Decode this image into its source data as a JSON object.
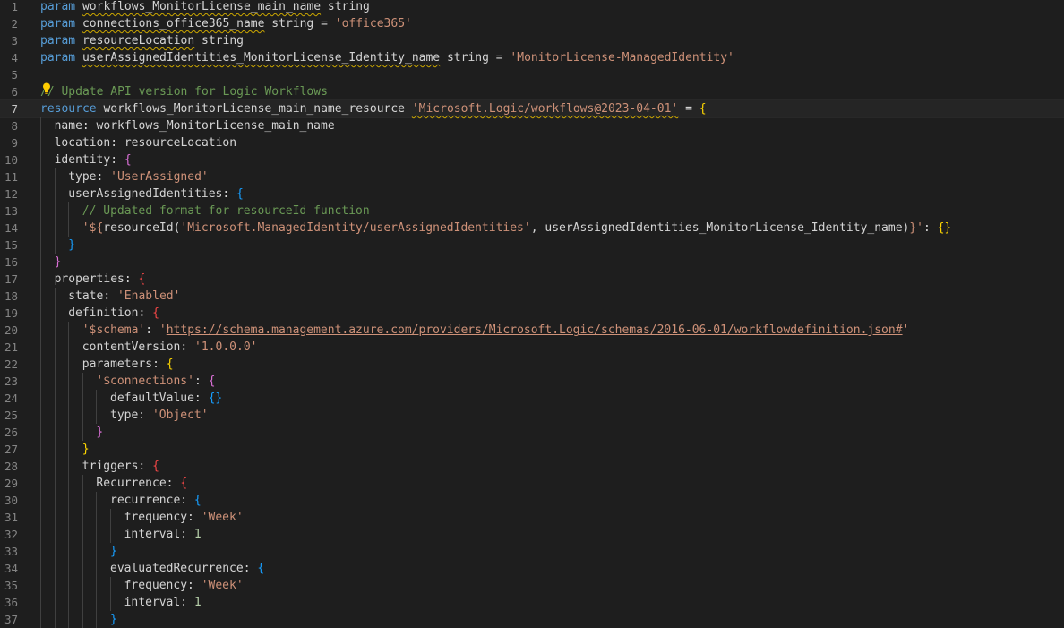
{
  "editor": {
    "lines": [
      {
        "n": "1",
        "indent": 0,
        "tokens": [
          [
            "kw",
            "param"
          ],
          [
            "id",
            " "
          ],
          [
            "id squig",
            "workflows_MonitorLicense_main_name"
          ],
          [
            "id",
            " string"
          ]
        ]
      },
      {
        "n": "2",
        "indent": 0,
        "tokens": [
          [
            "kw",
            "param"
          ],
          [
            "id",
            " "
          ],
          [
            "id squig",
            "connections_office365_name"
          ],
          [
            "id",
            " string = "
          ],
          [
            "str",
            "'office365'"
          ]
        ]
      },
      {
        "n": "3",
        "indent": 0,
        "tokens": [
          [
            "kw",
            "param"
          ],
          [
            "id",
            " "
          ],
          [
            "id squig",
            "resourceLocation"
          ],
          [
            "id",
            " string"
          ]
        ]
      },
      {
        "n": "4",
        "indent": 0,
        "tokens": [
          [
            "kw",
            "param"
          ],
          [
            "id",
            " "
          ],
          [
            "id squig",
            "userAssignedIdentities_MonitorLicense_Identity_name"
          ],
          [
            "id",
            " string = "
          ],
          [
            "str",
            "'MonitorLicense-ManagedIdentity'"
          ]
        ]
      },
      {
        "n": "5",
        "indent": 0,
        "tokens": []
      },
      {
        "n": "6",
        "indent": 0,
        "tokens": [
          [
            "cm",
            "// Update API version for Logic Workflows"
          ]
        ],
        "bulb": true
      },
      {
        "n": "7",
        "indent": 0,
        "current": true,
        "tokens": [
          [
            "kw",
            "resource"
          ],
          [
            "id",
            " workflows_MonitorLicense_main_name_resource "
          ],
          [
            "str squig",
            "'Microsoft.Logic/workflows@2023-04-01'"
          ],
          [
            "id",
            " = "
          ],
          [
            "b2",
            "{"
          ]
        ]
      },
      {
        "n": "8",
        "indent": 1,
        "tokens": [
          [
            "id",
            "name: workflows_MonitorLicense_main_name"
          ]
        ]
      },
      {
        "n": "9",
        "indent": 1,
        "tokens": [
          [
            "id",
            "location: resourceLocation"
          ]
        ]
      },
      {
        "n": "10",
        "indent": 1,
        "tokens": [
          [
            "id",
            "identity: "
          ],
          [
            "b1",
            "{"
          ]
        ]
      },
      {
        "n": "11",
        "indent": 2,
        "tokens": [
          [
            "id",
            "type: "
          ],
          [
            "str",
            "'UserAssigned'"
          ]
        ]
      },
      {
        "n": "12",
        "indent": 2,
        "tokens": [
          [
            "id",
            "userAssignedIdentities: "
          ],
          [
            "b3",
            "{"
          ]
        ]
      },
      {
        "n": "13",
        "indent": 3,
        "tokens": [
          [
            "cm",
            "// Updated format for resourceId function"
          ]
        ]
      },
      {
        "n": "14",
        "indent": 3,
        "tokens": [
          [
            "str",
            "'${"
          ],
          [
            "id",
            "resourceId("
          ],
          [
            "str",
            "'Microsoft.ManagedIdentity/userAssignedIdentities'"
          ],
          [
            "id",
            ", userAssignedIdentities_MonitorLicense_Identity_name)"
          ],
          [
            "str",
            "}'"
          ],
          [
            "id",
            ": "
          ],
          [
            "b2",
            "{}"
          ]
        ]
      },
      {
        "n": "15",
        "indent": 2,
        "tokens": [
          [
            "b3",
            "}"
          ]
        ]
      },
      {
        "n": "16",
        "indent": 1,
        "tokens": [
          [
            "b1",
            "}"
          ]
        ]
      },
      {
        "n": "17",
        "indent": 1,
        "tokens": [
          [
            "id",
            "properties: "
          ],
          [
            "b0",
            "{"
          ]
        ]
      },
      {
        "n": "18",
        "indent": 2,
        "tokens": [
          [
            "id",
            "state: "
          ],
          [
            "str",
            "'Enabled'"
          ]
        ]
      },
      {
        "n": "19",
        "indent": 2,
        "tokens": [
          [
            "id",
            "definition: "
          ],
          [
            "b0",
            "{"
          ]
        ]
      },
      {
        "n": "20",
        "indent": 3,
        "tokens": [
          [
            "str",
            "'$schema'"
          ],
          [
            "id",
            ": "
          ],
          [
            "str",
            "'"
          ],
          [
            "url",
            "https://schema.management.azure.com/providers/Microsoft.Logic/schemas/2016-06-01/workflowdefinition.json#"
          ],
          [
            "str",
            "'"
          ]
        ]
      },
      {
        "n": "21",
        "indent": 3,
        "tokens": [
          [
            "id",
            "contentVersion: "
          ],
          [
            "str",
            "'1.0.0.0'"
          ]
        ]
      },
      {
        "n": "22",
        "indent": 3,
        "tokens": [
          [
            "id",
            "parameters: "
          ],
          [
            "b2",
            "{"
          ]
        ]
      },
      {
        "n": "23",
        "indent": 4,
        "tokens": [
          [
            "str",
            "'$connections'"
          ],
          [
            "id",
            ": "
          ],
          [
            "b1",
            "{"
          ]
        ]
      },
      {
        "n": "24",
        "indent": 5,
        "tokens": [
          [
            "id",
            "defaultValue: "
          ],
          [
            "b3",
            "{}"
          ]
        ]
      },
      {
        "n": "25",
        "indent": 5,
        "tokens": [
          [
            "id",
            "type: "
          ],
          [
            "str",
            "'Object'"
          ]
        ]
      },
      {
        "n": "26",
        "indent": 4,
        "tokens": [
          [
            "b1",
            "}"
          ]
        ]
      },
      {
        "n": "27",
        "indent": 3,
        "tokens": [
          [
            "b2",
            "}"
          ]
        ]
      },
      {
        "n": "28",
        "indent": 3,
        "tokens": [
          [
            "id",
            "triggers: "
          ],
          [
            "b0",
            "{"
          ]
        ]
      },
      {
        "n": "29",
        "indent": 4,
        "tokens": [
          [
            "id",
            "Recurrence: "
          ],
          [
            "b0",
            "{"
          ]
        ]
      },
      {
        "n": "30",
        "indent": 5,
        "tokens": [
          [
            "id",
            "recurrence: "
          ],
          [
            "b3",
            "{"
          ]
        ]
      },
      {
        "n": "31",
        "indent": 6,
        "tokens": [
          [
            "id",
            "frequency: "
          ],
          [
            "str",
            "'Week'"
          ]
        ]
      },
      {
        "n": "32",
        "indent": 6,
        "tokens": [
          [
            "id",
            "interval: "
          ],
          [
            "num",
            "1"
          ]
        ]
      },
      {
        "n": "33",
        "indent": 5,
        "tokens": [
          [
            "b3",
            "}"
          ]
        ]
      },
      {
        "n": "34",
        "indent": 5,
        "tokens": [
          [
            "id",
            "evaluatedRecurrence: "
          ],
          [
            "b3",
            "{"
          ]
        ]
      },
      {
        "n": "35",
        "indent": 6,
        "tokens": [
          [
            "id",
            "frequency: "
          ],
          [
            "str",
            "'Week'"
          ]
        ]
      },
      {
        "n": "36",
        "indent": 6,
        "tokens": [
          [
            "id",
            "interval: "
          ],
          [
            "num",
            "1"
          ]
        ]
      },
      {
        "n": "37",
        "indent": 5,
        "tokens": [
          [
            "b3",
            "}"
          ]
        ]
      }
    ]
  }
}
